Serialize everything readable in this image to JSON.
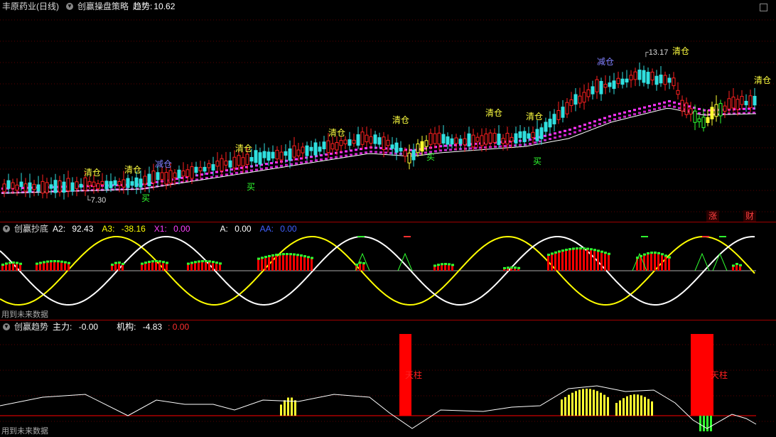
{
  "main": {
    "stock": "丰原药业",
    "period": "(日线)",
    "strategy": "创赢操盘策略",
    "trend_label": "趋势:",
    "trend_value": "10.62",
    "price_low": "7.30",
    "price_high": "13.17",
    "signals": [
      "清仓",
      "清仓",
      "减仓",
      "清仓",
      "清仓",
      "清仓",
      "清仓",
      "清仓",
      "减仓",
      "清仓",
      "清仓"
    ],
    "buys": [
      "买",
      "买",
      "买",
      "买"
    ],
    "badges": [
      "涨",
      "财"
    ]
  },
  "bottom_finder": {
    "title": "创赢抄底",
    "a2_label": "A2:",
    "a2_value": "92.43",
    "a3_label": "A3:",
    "a3_value": "-38.16",
    "x1_label": "X1:",
    "x1_value": "0.00",
    "a_label": "A:",
    "a_value": "0.00",
    "aa_label": "AA:",
    "aa_value": "0.00",
    "footnote": "用到未来数据",
    "colors": {
      "yellow": "#ffff00",
      "white": "#ffffff",
      "red": "#ff0000",
      "green": "#00ff00",
      "magenta": "#ff40ff",
      "blue": "#4040ff"
    }
  },
  "trend_panel": {
    "title": "创赢趋势",
    "main_force_label": "主力:",
    "main_force_value": "-0.00",
    "institution_label": "机构:",
    "institution_value": "-4.83",
    "institution_extra": ": 0.00",
    "pillar_label": "天柱",
    "footnote": "用到未来数据"
  }
}
